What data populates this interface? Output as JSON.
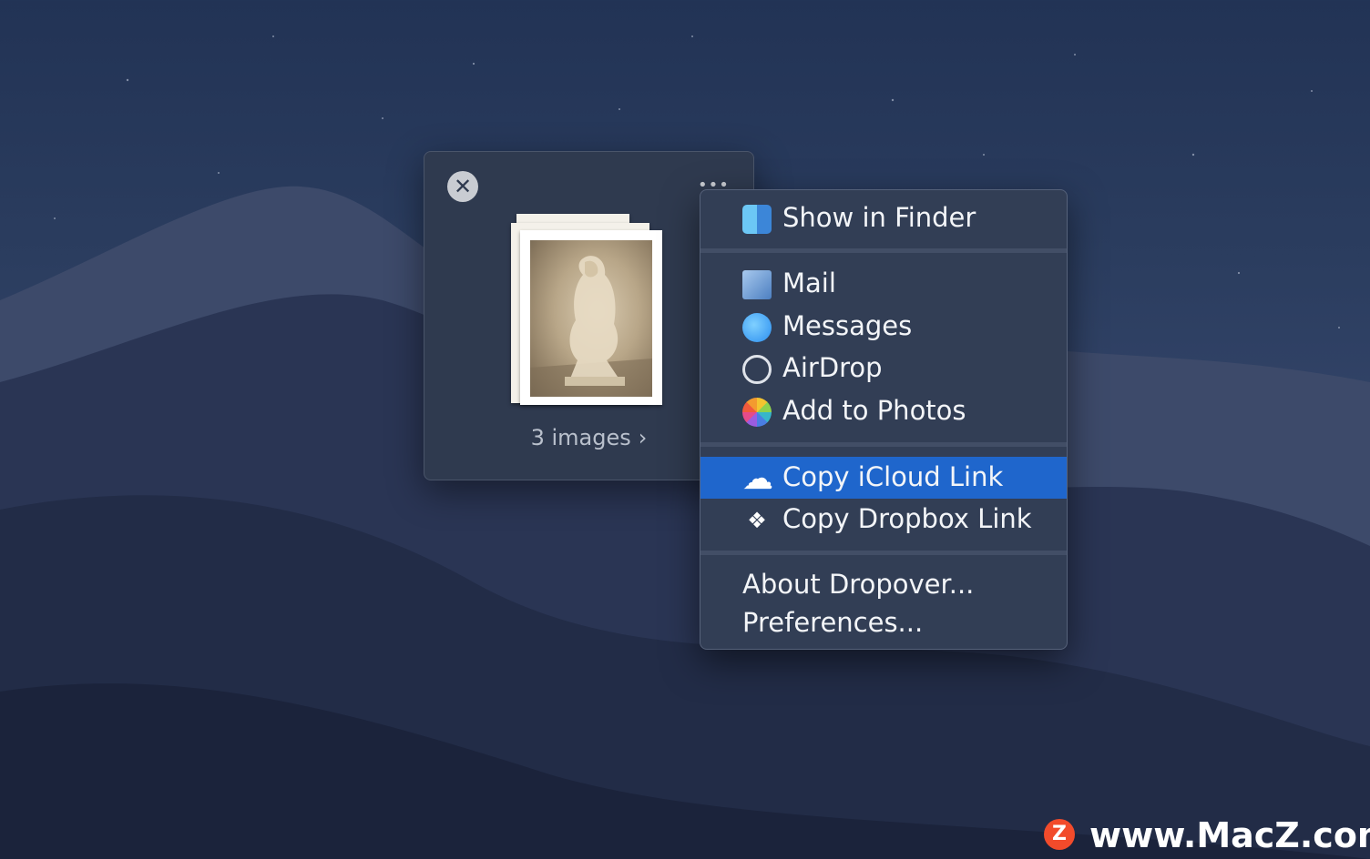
{
  "shelf": {
    "close_icon": "close-icon",
    "more_icon": "ellipsis-icon",
    "more_glyph": "•••",
    "caption": "3 images",
    "chevron_glyph": "›"
  },
  "menu": {
    "items": [
      {
        "label": "Show in Finder",
        "icon": "finder-icon"
      },
      {
        "label": "Mail",
        "icon": "mail-icon"
      },
      {
        "label": "Messages",
        "icon": "messages-icon"
      },
      {
        "label": "AirDrop",
        "icon": "airdrop-icon"
      },
      {
        "label": "Add to Photos",
        "icon": "photos-icon"
      },
      {
        "label": "Copy iCloud Link",
        "icon": "icloud-icon",
        "selected": true
      },
      {
        "label": "Copy Dropbox Link",
        "icon": "dropbox-icon"
      },
      {
        "label": "About Dropover..."
      },
      {
        "label": "Preferences..."
      }
    ],
    "selected_color": "#1f66cc"
  },
  "watermark": {
    "logo_letter": "Z",
    "text": "www.MacZ.com"
  }
}
